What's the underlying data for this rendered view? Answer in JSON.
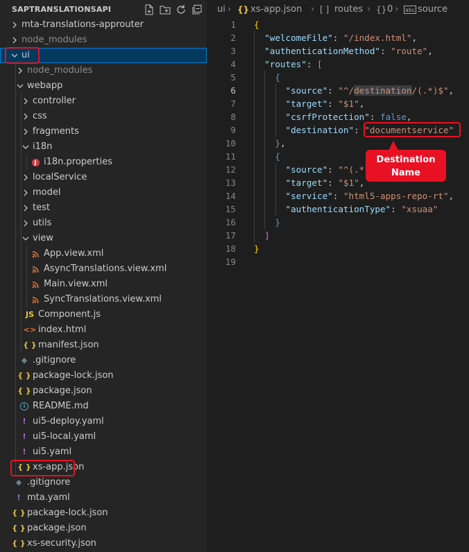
{
  "explorer": {
    "title": "SAPTRANSLATIONSAPI",
    "actions": [
      "new-file-icon",
      "new-folder-icon",
      "refresh-icon",
      "collapse-all-icon"
    ],
    "items": [
      {
        "label": "mta-translations-approuter",
        "type": "folder",
        "depth": 0,
        "open": false
      },
      {
        "label": "node_modules",
        "type": "folder",
        "depth": 0,
        "open": false,
        "dim": true
      },
      {
        "label": "ui",
        "type": "folder",
        "depth": 0,
        "open": true,
        "selected": true
      },
      {
        "label": "node_modules",
        "type": "folder",
        "depth": 1,
        "open": false,
        "dim": true
      },
      {
        "label": "webapp",
        "type": "folder",
        "depth": 1,
        "open": true
      },
      {
        "label": "controller",
        "type": "folder",
        "depth": 2,
        "open": false
      },
      {
        "label": "css",
        "type": "folder",
        "depth": 2,
        "open": false
      },
      {
        "label": "fragments",
        "type": "folder",
        "depth": 2,
        "open": false
      },
      {
        "label": "i18n",
        "type": "folder",
        "depth": 2,
        "open": true
      },
      {
        "label": "i18n.properties",
        "type": "properties",
        "depth": 3
      },
      {
        "label": "localService",
        "type": "folder",
        "depth": 2,
        "open": false
      },
      {
        "label": "model",
        "type": "folder",
        "depth": 2,
        "open": false
      },
      {
        "label": "test",
        "type": "folder",
        "depth": 2,
        "open": false
      },
      {
        "label": "utils",
        "type": "folder",
        "depth": 2,
        "open": false
      },
      {
        "label": "view",
        "type": "folder",
        "depth": 2,
        "open": true
      },
      {
        "label": "App.view.xml",
        "type": "xml",
        "depth": 3
      },
      {
        "label": "AsyncTranslations.view.xml",
        "type": "xml",
        "depth": 3
      },
      {
        "label": "Main.view.xml",
        "type": "xml",
        "depth": 3
      },
      {
        "label": "SyncTranslations.view.xml",
        "type": "xml",
        "depth": 3
      },
      {
        "label": "Component.js",
        "type": "js",
        "depth": 2
      },
      {
        "label": "index.html",
        "type": "html",
        "depth": 2
      },
      {
        "label": "manifest.json",
        "type": "json",
        "depth": 2
      },
      {
        "label": ".gitignore",
        "type": "git",
        "depth": 1
      },
      {
        "label": "package-lock.json",
        "type": "json",
        "depth": 1
      },
      {
        "label": "package.json",
        "type": "json",
        "depth": 1
      },
      {
        "label": "README.md",
        "type": "info",
        "depth": 1
      },
      {
        "label": "ui5-deploy.yaml",
        "type": "yaml",
        "depth": 1
      },
      {
        "label": "ui5-local.yaml",
        "type": "yaml",
        "depth": 1
      },
      {
        "label": "ui5.yaml",
        "type": "yaml",
        "depth": 1
      },
      {
        "label": "xs-app.json",
        "type": "json",
        "depth": 1,
        "boxed": true
      },
      {
        "label": ".gitignore",
        "type": "git",
        "depth": 0
      },
      {
        "label": "mta.yaml",
        "type": "yaml",
        "depth": 0
      },
      {
        "label": "package-lock.json",
        "type": "json",
        "depth": 0
      },
      {
        "label": "package.json",
        "type": "json",
        "depth": 0
      },
      {
        "label": "xs-security.json",
        "type": "json",
        "depth": 0
      }
    ]
  },
  "breadcrumb": {
    "folder": "ui",
    "file_icon": "{}",
    "file": "xs-app.json",
    "sep": "›",
    "seg1_icon": "[ ]",
    "seg1": "routes",
    "seg2_icon": "{}",
    "seg2": "0",
    "seg3_icon": "abc",
    "seg3": "source"
  },
  "code": {
    "current_line": 6,
    "lines": [
      [
        [
          "{",
          "y"
        ]
      ],
      [
        [
          "  ",
          ""
        ],
        [
          "\"welcomeFile\"",
          "k"
        ],
        [
          ": ",
          "p"
        ],
        [
          "\"/index.html\"",
          "s"
        ],
        [
          ",",
          "p"
        ]
      ],
      [
        [
          "  ",
          ""
        ],
        [
          "\"authenticationMethod\"",
          "k"
        ],
        [
          ": ",
          "p"
        ],
        [
          "\"route\"",
          "s"
        ],
        [
          ",",
          "p"
        ]
      ],
      [
        [
          "  ",
          ""
        ],
        [
          "\"routes\"",
          "k"
        ],
        [
          ": ",
          "p"
        ],
        [
          "[",
          "m"
        ]
      ],
      [
        [
          "    ",
          ""
        ],
        [
          "{",
          "b"
        ]
      ],
      [
        [
          "      ",
          ""
        ],
        [
          "\"source\"",
          "k"
        ],
        [
          ": ",
          "p"
        ],
        [
          "\"^/",
          "s"
        ],
        [
          "destination",
          "s hl"
        ],
        [
          "/(.*)$\"",
          "s"
        ],
        [
          ",",
          "p"
        ]
      ],
      [
        [
          "      ",
          ""
        ],
        [
          "\"target\"",
          "k"
        ],
        [
          ": ",
          "p"
        ],
        [
          "\"$1\"",
          "s"
        ],
        [
          ",",
          "p"
        ]
      ],
      [
        [
          "      ",
          ""
        ],
        [
          "\"csrfProtection\"",
          "k"
        ],
        [
          ": ",
          "p"
        ],
        [
          "false",
          "b"
        ],
        [
          ",",
          "p"
        ]
      ],
      [
        [
          "      ",
          ""
        ],
        [
          "\"destination\"",
          "k"
        ],
        [
          ": ",
          "p"
        ],
        [
          "\"documentservice\"",
          "s"
        ]
      ],
      [
        [
          "    ",
          ""
        ],
        [
          "}",
          "b"
        ],
        [
          ",",
          "p"
        ]
      ],
      [
        [
          "    ",
          ""
        ],
        [
          "{",
          "b"
        ]
      ],
      [
        [
          "      ",
          ""
        ],
        [
          "\"source\"",
          "k"
        ],
        [
          ": ",
          "p"
        ],
        [
          "\"^(.*",
          "s"
        ]
      ],
      [
        [
          "      ",
          ""
        ],
        [
          "\"target\"",
          "k"
        ],
        [
          ": ",
          "p"
        ],
        [
          "\"$1\"",
          "s"
        ],
        [
          ",",
          "p"
        ]
      ],
      [
        [
          "      ",
          ""
        ],
        [
          "\"service\"",
          "k"
        ],
        [
          ": ",
          "p"
        ],
        [
          "\"html5-apps-repo-rt\"",
          "s"
        ],
        [
          ",",
          "p"
        ]
      ],
      [
        [
          "      ",
          ""
        ],
        [
          "\"authenticationType\"",
          "k"
        ],
        [
          ": ",
          "p"
        ],
        [
          "\"xsuaa\"",
          "s"
        ]
      ],
      [
        [
          "    ",
          ""
        ],
        [
          "}",
          "b"
        ]
      ],
      [
        [
          "  ",
          ""
        ],
        [
          "]",
          "m"
        ]
      ],
      [
        [
          "}",
          "y"
        ]
      ],
      [
        [
          "",
          ""
        ]
      ]
    ]
  },
  "callout": {
    "line1": "Destination",
    "line2": "Name"
  },
  "colors": {
    "highlight_red": "#e81123",
    "selection": "#04395e",
    "focus_border": "#007fd4"
  }
}
